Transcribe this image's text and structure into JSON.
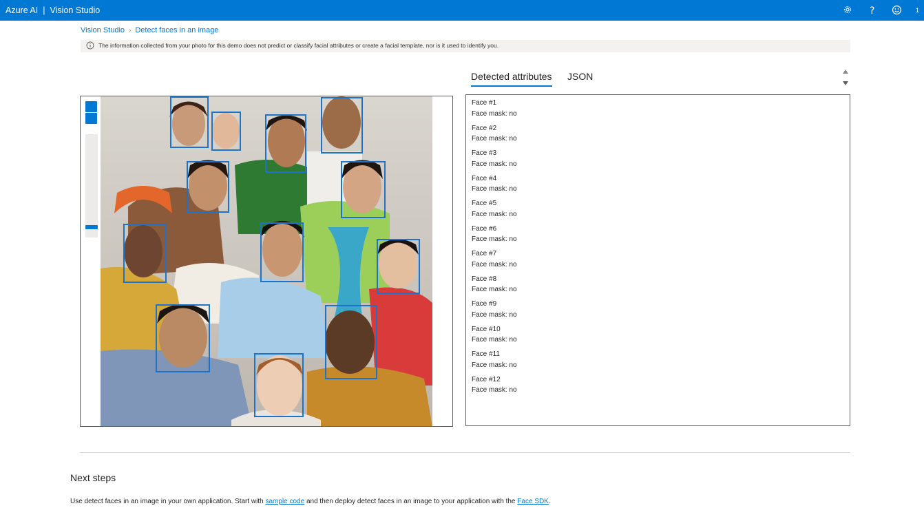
{
  "header": {
    "brand": "Azure AI",
    "separator": "|",
    "app_name": "Vision Studio",
    "icons": [
      "gear-icon",
      "help-icon",
      "feedback-smiley-icon"
    ],
    "notification_count": "1"
  },
  "breadcrumb": {
    "items": [
      "Vision Studio",
      "Detect faces in an image"
    ]
  },
  "info_banner": {
    "icon": "info-icon",
    "text": "The information collected from your photo for this demo does not predict or classify facial attributes or create a facial template, nor is it used to identify you."
  },
  "tabs": [
    {
      "label": "Detected attributes",
      "active": true
    },
    {
      "label": "JSON",
      "active": false
    }
  ],
  "image_viewer": {
    "zoom_in_label": "+",
    "zoom_out_label": "−",
    "zoom_level": 0.92,
    "detected_faces_count": 12
  },
  "results": [
    {
      "face": "Face #1",
      "mask": "Face mask: no"
    },
    {
      "face": "Face #2",
      "mask": "Face mask: no"
    },
    {
      "face": "Face #3",
      "mask": "Face mask: no"
    },
    {
      "face": "Face #4",
      "mask": "Face mask: no"
    },
    {
      "face": "Face #5",
      "mask": "Face mask: no"
    },
    {
      "face": "Face #6",
      "mask": "Face mask: no"
    },
    {
      "face": "Face #7",
      "mask": "Face mask: no"
    },
    {
      "face": "Face #8",
      "mask": "Face mask: no"
    },
    {
      "face": "Face #9",
      "mask": "Face mask: no"
    },
    {
      "face": "Face #10",
      "mask": "Face mask: no"
    },
    {
      "face": "Face #11",
      "mask": "Face mask: no"
    },
    {
      "face": "Face #12",
      "mask": "Face mask: no"
    }
  ],
  "next_steps": {
    "title": "Next steps",
    "text_before": "Use detect faces in an image in your own application. Start with ",
    "link1": "sample code",
    "text_middle": " and then deploy detect faces in an image to your application with the ",
    "link2": "Face SDK",
    "text_after": "."
  },
  "colors": {
    "accent": "#0078d4",
    "face_box": "#1e73c8",
    "banner_bg": "#f3f2f1"
  }
}
